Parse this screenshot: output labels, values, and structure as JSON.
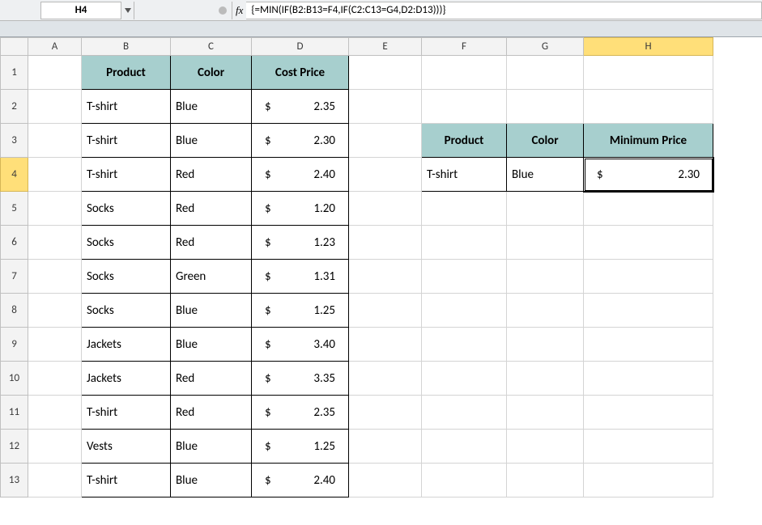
{
  "nameBox": "H4",
  "formula": "{=MIN(IF(B2:B13=F4,IF(C2:C13=G4,D2:D13)))}",
  "fxLabel": "fx",
  "cols": [
    "A",
    "B",
    "C",
    "D",
    "E",
    "F",
    "G",
    "H"
  ],
  "rows": [
    "1",
    "2",
    "3",
    "4",
    "5",
    "6",
    "7",
    "8",
    "9",
    "10",
    "11",
    "12",
    "13"
  ],
  "selectedCol": "H",
  "selectedRow": "4",
  "mainTable": {
    "headers": [
      "Product",
      "Color",
      "Cost Price"
    ],
    "rows": [
      {
        "product": "T-shirt",
        "color": "Blue",
        "cost": "2.35"
      },
      {
        "product": "T-shirt",
        "color": "Blue",
        "cost": "2.30"
      },
      {
        "product": "T-shirt",
        "color": "Red",
        "cost": "2.40"
      },
      {
        "product": "Socks",
        "color": "Red",
        "cost": "1.20"
      },
      {
        "product": "Socks",
        "color": "Red",
        "cost": "1.23"
      },
      {
        "product": "Socks",
        "color": "Green",
        "cost": "1.31"
      },
      {
        "product": "Socks",
        "color": "Blue",
        "cost": "1.25"
      },
      {
        "product": "Jackets",
        "color": "Blue",
        "cost": "3.40"
      },
      {
        "product": "Jackets",
        "color": "Red",
        "cost": "3.35"
      },
      {
        "product": "T-shirt",
        "color": "Red",
        "cost": "2.35"
      },
      {
        "product": "Vests",
        "color": "Blue",
        "cost": "1.25"
      },
      {
        "product": "T-shirt",
        "color": "Blue",
        "cost": "2.40"
      }
    ]
  },
  "lookup": {
    "headers": [
      "Product",
      "Color",
      "Minimum Price"
    ],
    "product": "T-shirt",
    "color": "Blue",
    "minPrice": "2.30"
  },
  "currency": "$"
}
